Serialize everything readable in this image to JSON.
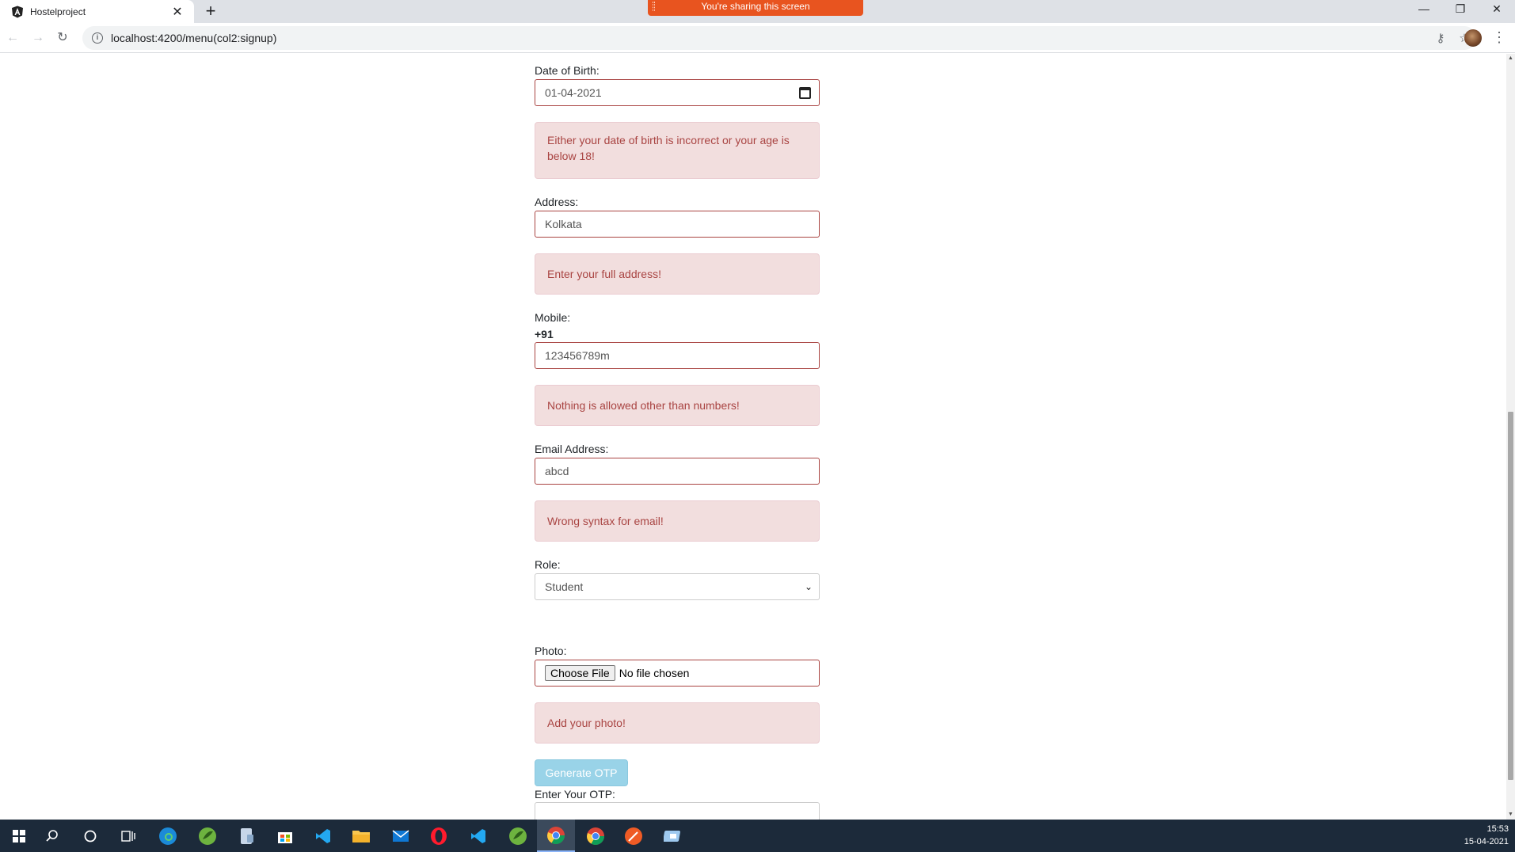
{
  "browser": {
    "tab_title": "Hostelproject",
    "tab_close": "✕",
    "new_tab": "+",
    "share_banner": "You're sharing this screen",
    "url": "localhost:4200/menu(col2:signup)"
  },
  "form": {
    "dob_label": "Date of Birth:",
    "dob_value": "01-04-2021",
    "dob_error": "Either your date of birth is incorrect or your age is below 18!",
    "address_label": "Address:",
    "address_value": "Kolkata",
    "address_error": "Enter your full address!",
    "mobile_label": "Mobile:",
    "mobile_prefix": "+91",
    "mobile_value": "123456789m",
    "mobile_error": "Nothing is allowed other than numbers!",
    "email_label": "Email Address:",
    "email_value": "abcd",
    "email_error": "Wrong syntax for email!",
    "role_label": "Role:",
    "role_value": "Student",
    "photo_label": "Photo:",
    "choose_file": "Choose File",
    "no_file": "No file chosen",
    "photo_error": "Add your photo!",
    "generate_otp": "Generate OTP",
    "otp_label": "Enter Your OTP:"
  },
  "taskbar": {
    "time": "15:53",
    "date": "15-04-2021"
  },
  "colors": {
    "error_text": "#a94442",
    "error_bg": "#f2dede",
    "otp_button": "#99d3e8",
    "share_banner": "#e8541f",
    "taskbar": "#1c2a3a"
  }
}
